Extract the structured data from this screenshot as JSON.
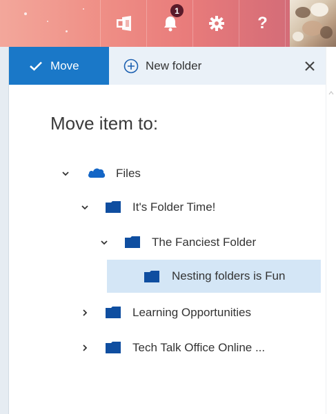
{
  "header": {
    "notification_count": "1",
    "icons": [
      "office-apps-icon",
      "bell-icon",
      "gear-icon",
      "help-icon",
      "avatar"
    ],
    "help_label": "?"
  },
  "toolbar": {
    "move_label": "Move",
    "new_folder_label": "New folder"
  },
  "dialog": {
    "title": "Move item to:"
  },
  "tree": {
    "root": {
      "label": "Files",
      "expanded": true
    },
    "items": [
      {
        "label": "It's Folder Time!",
        "expanded": true,
        "level": 1
      },
      {
        "label": "The Fanciest Folder",
        "expanded": true,
        "level": 2
      },
      {
        "label": "Nesting folders is Fun",
        "selected": true,
        "level": 3
      },
      {
        "label": "Learning Opportunities",
        "expanded": false,
        "level": 1
      },
      {
        "label": "Tech Talk Office Online ...",
        "expanded": false,
        "level": 1
      }
    ]
  },
  "colors": {
    "accent": "#1a78c8",
    "folder": "#0f4ea0",
    "selected_row": "#d4e6f6",
    "toolbar_bg": "#eaf1f8"
  }
}
